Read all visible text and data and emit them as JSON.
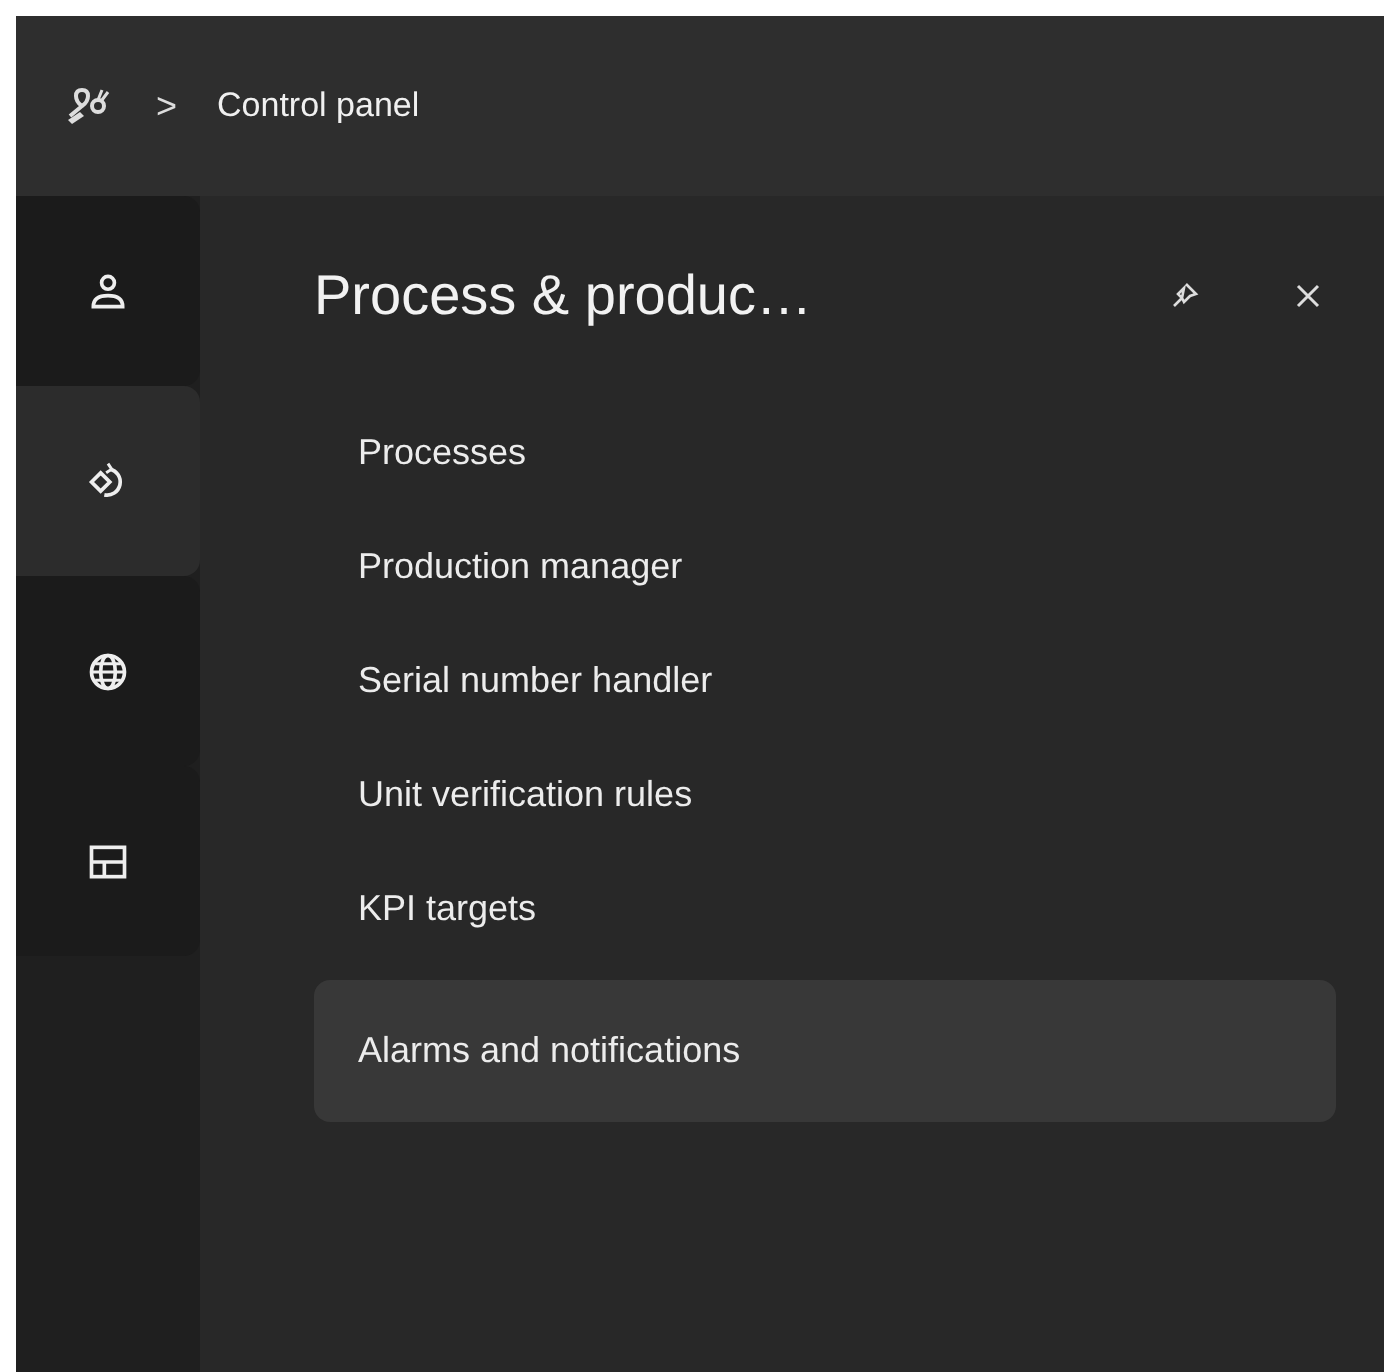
{
  "breadcrumb": {
    "separator": ">",
    "current": "Control panel"
  },
  "rail": [
    {
      "kind": "user",
      "selected": false
    },
    {
      "kind": "rotate",
      "selected": true
    },
    {
      "kind": "globe",
      "selected": false
    },
    {
      "kind": "layout",
      "selected": false
    }
  ],
  "panel": {
    "title": "Process & produc…",
    "items": [
      {
        "label": "Processes",
        "selected": false
      },
      {
        "label": "Production manager",
        "selected": false
      },
      {
        "label": "Serial number handler",
        "selected": false
      },
      {
        "label": "Unit verification rules",
        "selected": false
      },
      {
        "label": "KPI targets",
        "selected": false
      },
      {
        "label": "Alarms and notifications",
        "selected": true
      }
    ]
  }
}
